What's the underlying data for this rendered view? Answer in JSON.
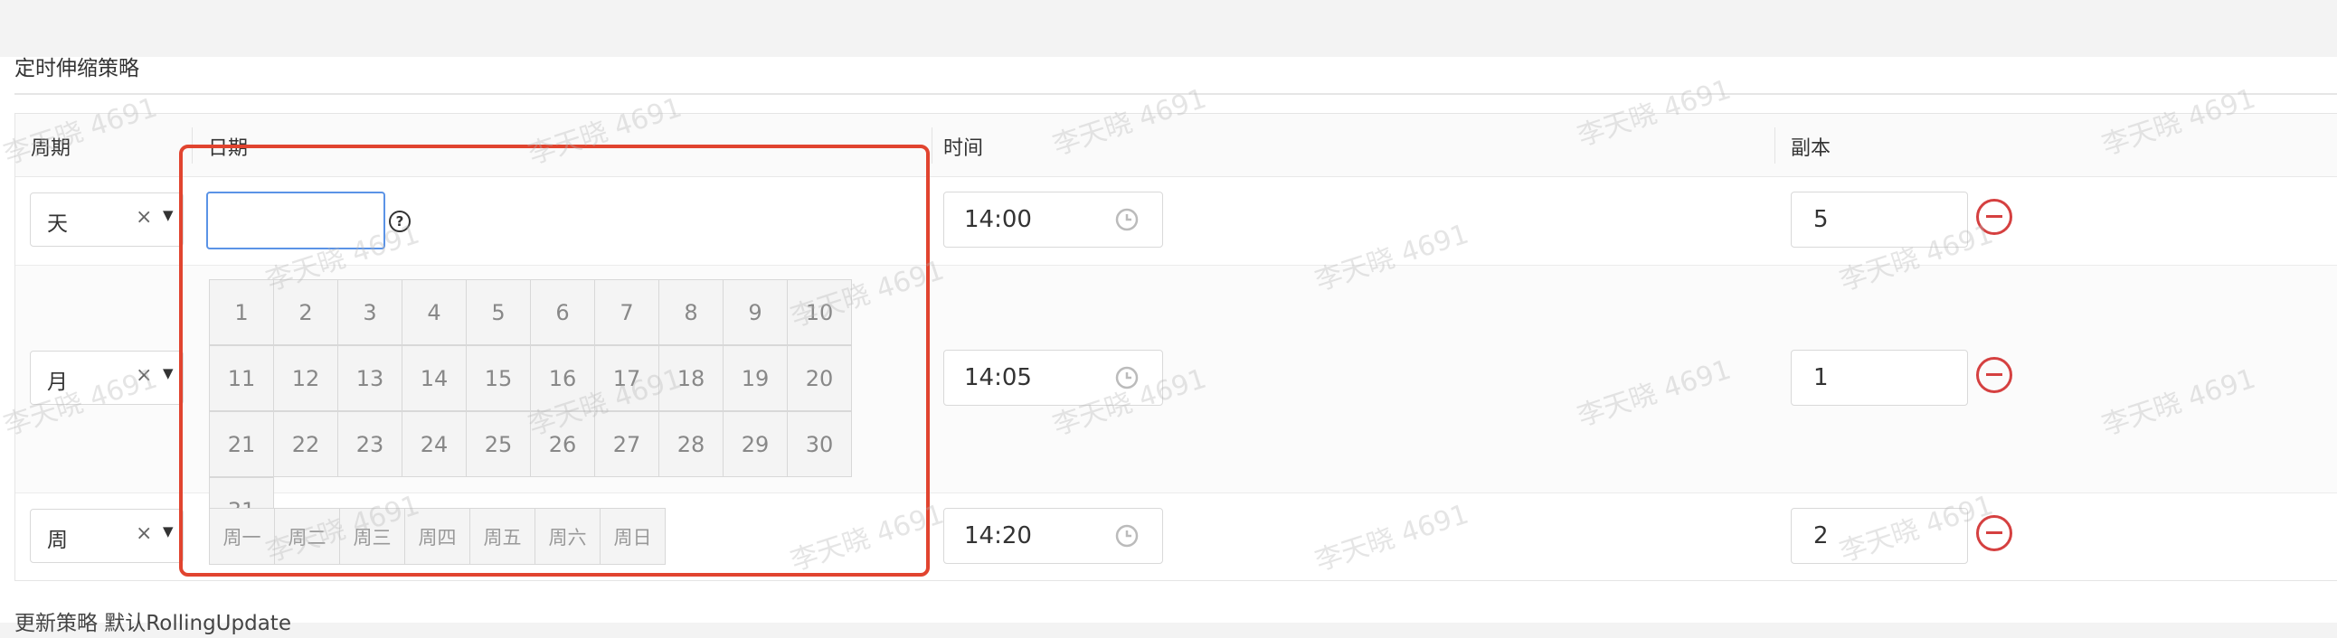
{
  "section_title": "定时伸缩策略",
  "columns": {
    "period": "周期",
    "date": "日期",
    "time": "时间",
    "replicas": "副本"
  },
  "rows": [
    {
      "period": "天",
      "clear": "×",
      "time": "14:00",
      "replicas": "5"
    },
    {
      "period": "月",
      "clear": "×",
      "time": "14:05",
      "replicas": "1"
    },
    {
      "period": "周",
      "clear": "×",
      "time": "14:20",
      "replicas": "2"
    }
  ],
  "date_picker": {
    "input_value": "",
    "help_icon": "?",
    "days": [
      "1",
      "2",
      "3",
      "4",
      "5",
      "6",
      "7",
      "8",
      "9",
      "10",
      "11",
      "12",
      "13",
      "14",
      "15",
      "16",
      "17",
      "18",
      "19",
      "20",
      "21",
      "22",
      "23",
      "24",
      "25",
      "26",
      "27",
      "28",
      "29",
      "30",
      "31"
    ],
    "weekdays": [
      "周一",
      "周二",
      "周三",
      "周四",
      "周五",
      "周六",
      "周日"
    ]
  },
  "footer_text": "更新策略    默认RollingUpdate",
  "watermark": "李天晓 4691",
  "icons": {
    "clear": "close-icon",
    "dropdown": "caret-down-icon",
    "clock": "clock-icon",
    "remove": "minus-circle-icon",
    "help": "question-circle-icon"
  },
  "colors": {
    "highlight_border": "#e1442f",
    "remove_icon": "#d54040",
    "focus_border": "#5b93e6"
  }
}
